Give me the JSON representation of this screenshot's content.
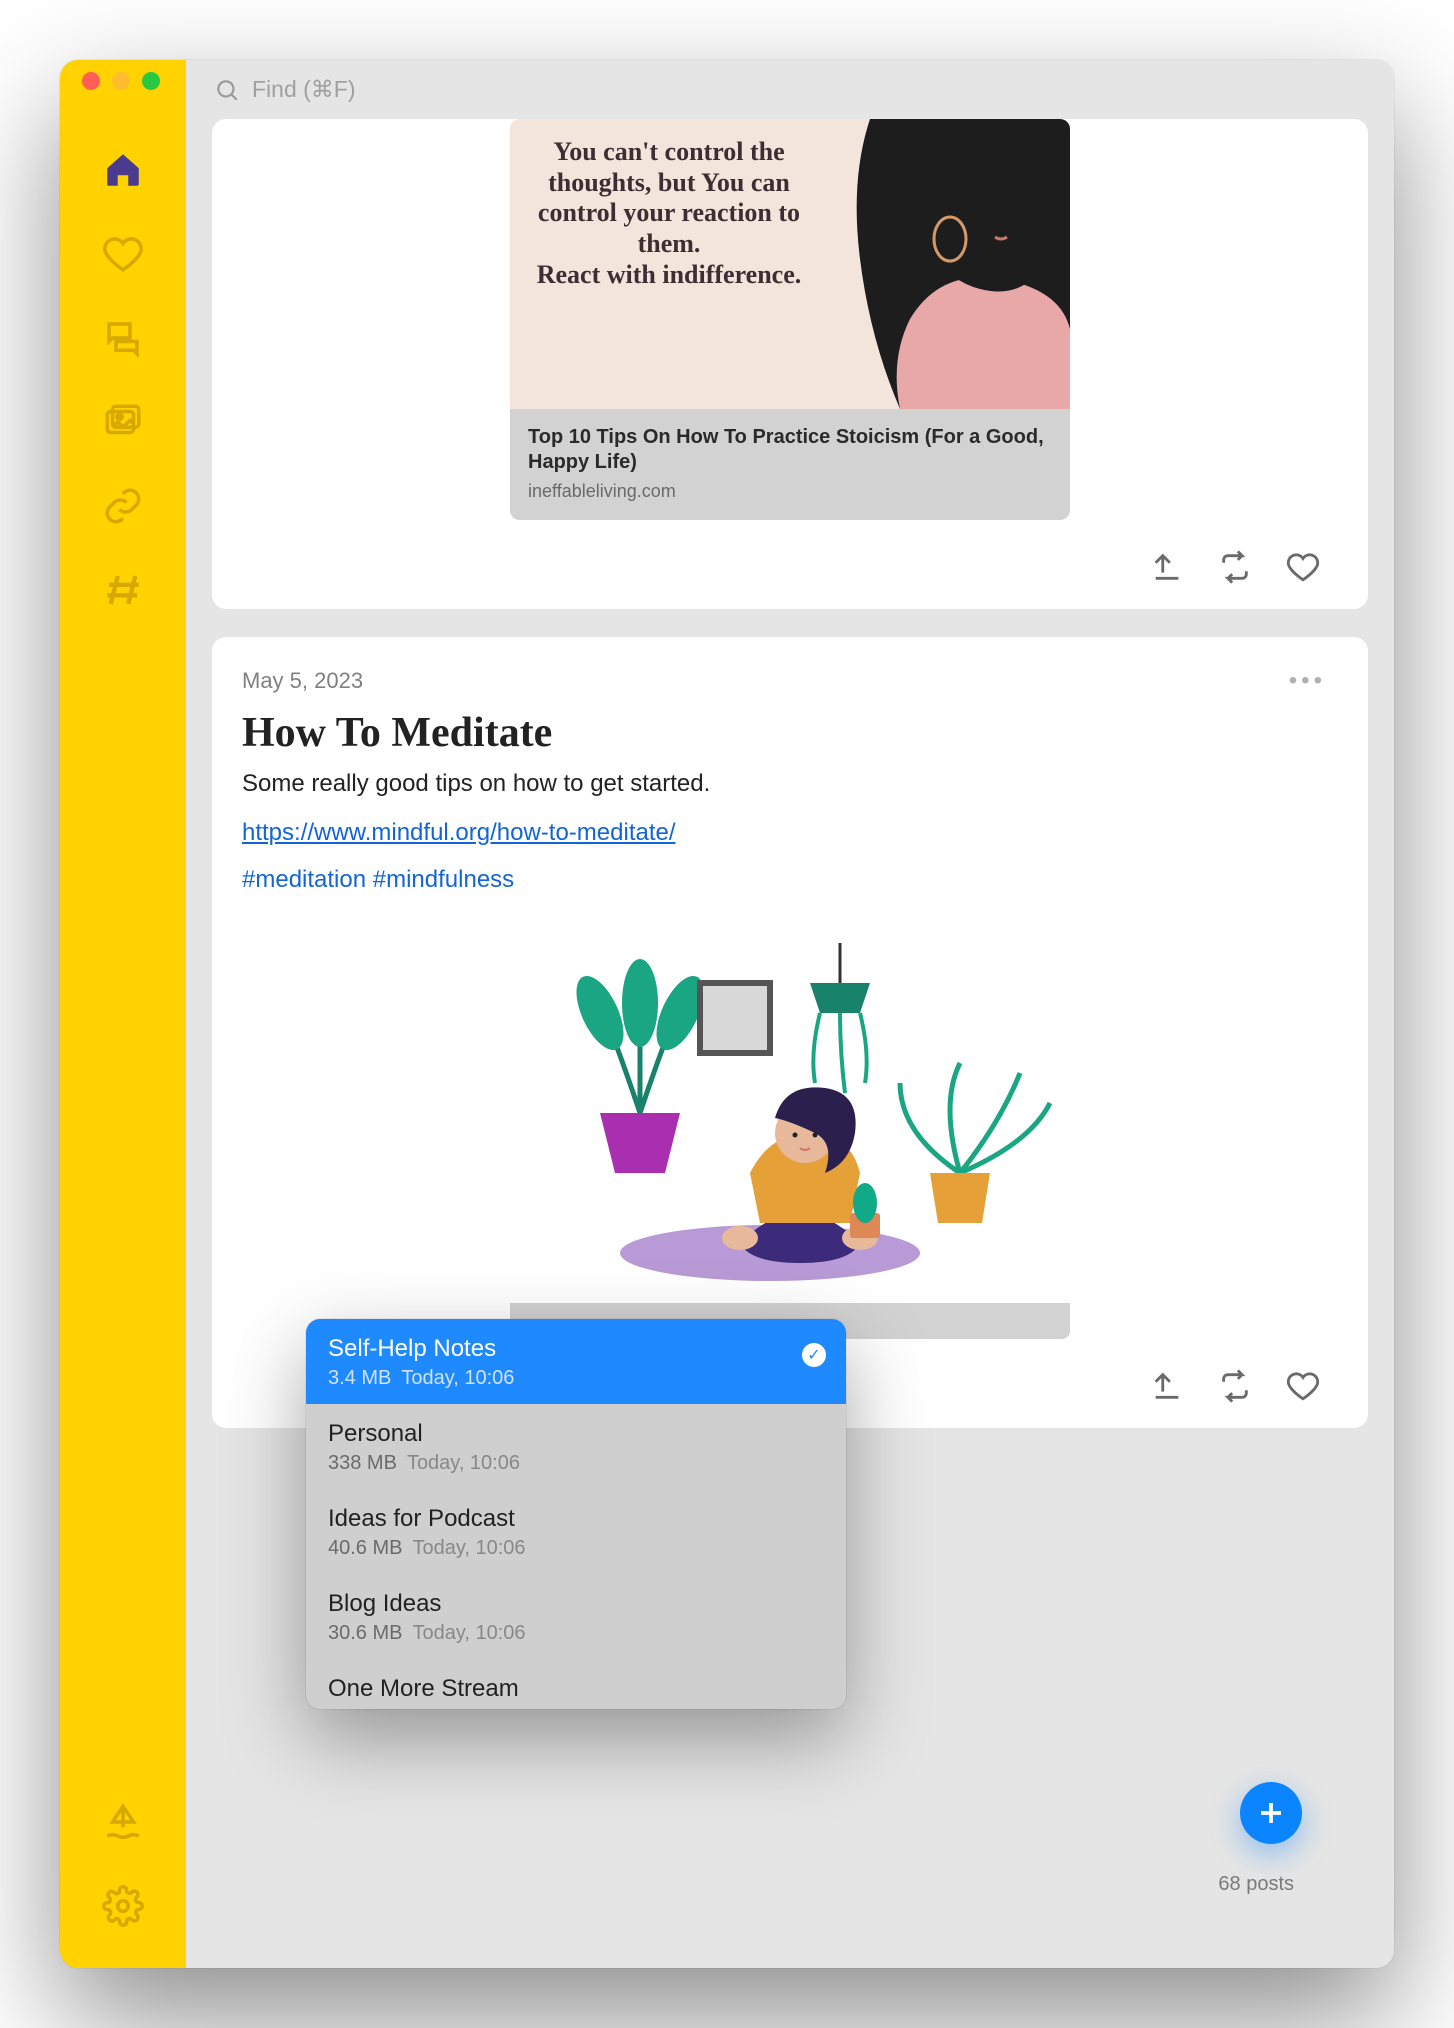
{
  "search": {
    "placeholder": "Find (⌘F)"
  },
  "card1": {
    "quote": "You can't control the thoughts, but You can control your reaction to them.\nReact with indifference.",
    "link_title": "Top 10 Tips On How To Practice Stoicism (For a Good, Happy Life)",
    "link_domain": "ineffableliving.com"
  },
  "card2": {
    "date": "May 5, 2023",
    "title": "How To Meditate",
    "body": "Some really good tips on how to get started.",
    "url": "https://www.mindful.org/how-to-meditate/",
    "tag1": "#meditation",
    "tag2": "#mindfulness"
  },
  "popover": {
    "items": [
      {
        "name": "Self-Help Notes",
        "size": "3.4 MB",
        "dt": "Today, 10:06",
        "selected": true
      },
      {
        "name": "Personal",
        "size": "338 MB",
        "dt": "Today, 10:06",
        "selected": false
      },
      {
        "name": "Ideas for Podcast",
        "size": "40.6 MB",
        "dt": "Today, 10:06",
        "selected": false
      },
      {
        "name": "Blog Ideas",
        "size": "30.6 MB",
        "dt": "Today, 10:06",
        "selected": false
      },
      {
        "name": "One More Stream",
        "size": "",
        "dt": "",
        "selected": false
      }
    ]
  },
  "footer": {
    "posts": "68 posts"
  }
}
